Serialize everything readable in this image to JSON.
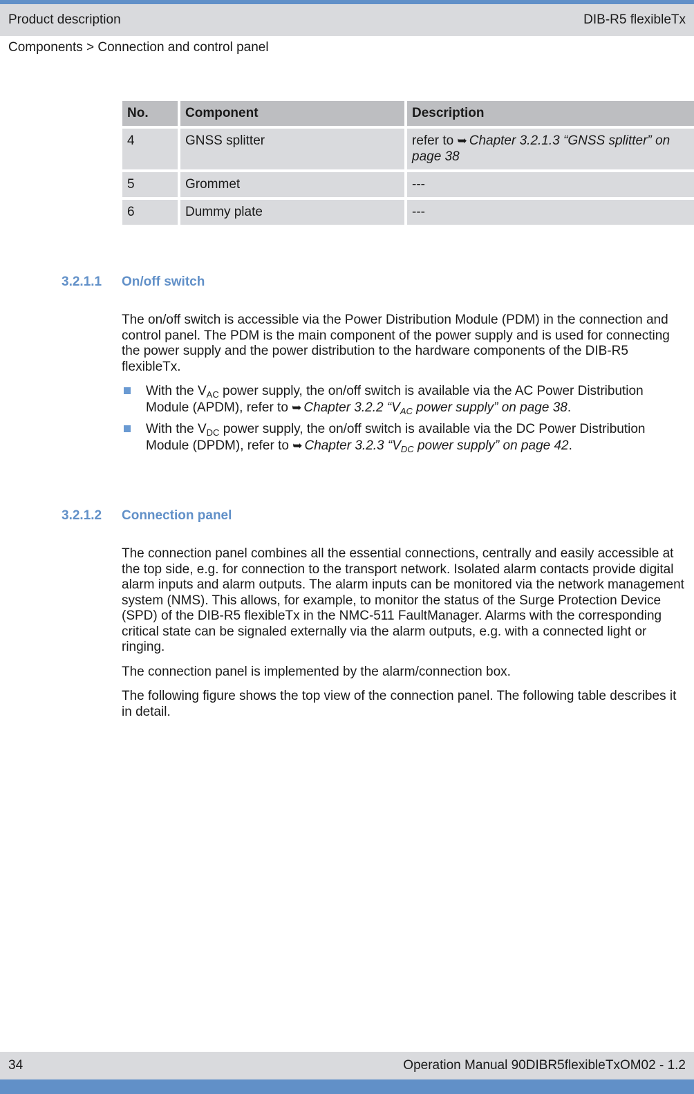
{
  "header": {
    "section": "Product description",
    "product": "DIB-R5 flexibleTx"
  },
  "breadcrumb": "Components > Connection and control panel",
  "table": {
    "headers": [
      "No.",
      "Component",
      "Description"
    ],
    "rows": [
      {
        "no": "4",
        "component": "GNSS splitter",
        "desc_prefix": "refer to ",
        "desc_link": "Chapter 3.2.1.3 “GNSS splitter” on page 38"
      },
      {
        "no": "5",
        "component": "Grommet",
        "desc": "---"
      },
      {
        "no": "6",
        "component": "Dummy plate",
        "desc": "---"
      }
    ]
  },
  "sections": [
    {
      "number": "3.2.1.1",
      "title": "On/off switch",
      "paragraph": "The on/off switch is accessible via the Power Distribution Module (PDM) in the connection and control panel. The PDM is the main component of the power supply and is used for connecting the power supply and the power distribution to the hardware components of the DIB-R5 flexibleTx.",
      "bullets": [
        {
          "pre": "With the V",
          "sub": "AC",
          "mid": " power supply, the on/off switch is available via the AC Power Distribu­tion Module (APDM), refer to ",
          "link_pre": "Chapter 3.2.2 “V",
          "link_sub": "AC",
          "link_post": " power supply” on page 38",
          "end": "."
        },
        {
          "pre": "With the V",
          "sub": "DC",
          "mid": " power supply, the on/off switch is available via the DC Power Distribu­tion Module (DPDM), refer to ",
          "link_pre": "Chapter 3.2.3 “V",
          "link_sub": "DC",
          "link_post": " power supply” on page 42",
          "end": "."
        }
      ]
    },
    {
      "number": "3.2.1.2",
      "title": "Connection panel",
      "paragraphs": [
        "The connection panel combines all the essential connections, centrally and easily acces­sible at the top side, e.g. for connection to the transport network. Isolated alarm contacts provide digital alarm inputs and alarm outputs. The alarm inputs can be monitored via the network management system (NMS). This allows, for example, to monitor the status of the Surge Protection Device (SPD) of the DIB-R5 flexibleTx in the NMC-511 FaultMan­ager. Alarms with the corresponding critical state can be signaled externally via the alarm outputs, e.g. with a connected light or ringing.",
        "The connection panel is implemented by the alarm/connection box.",
        "The following figure shows the top view of the connection panel. The following table describes it in detail."
      ]
    }
  ],
  "icons": {
    "cross_reference": "➥"
  },
  "footer": {
    "page_number": "34",
    "document": "Operation Manual 90DIBR5flexibleTxOM02 - 1.2"
  }
}
